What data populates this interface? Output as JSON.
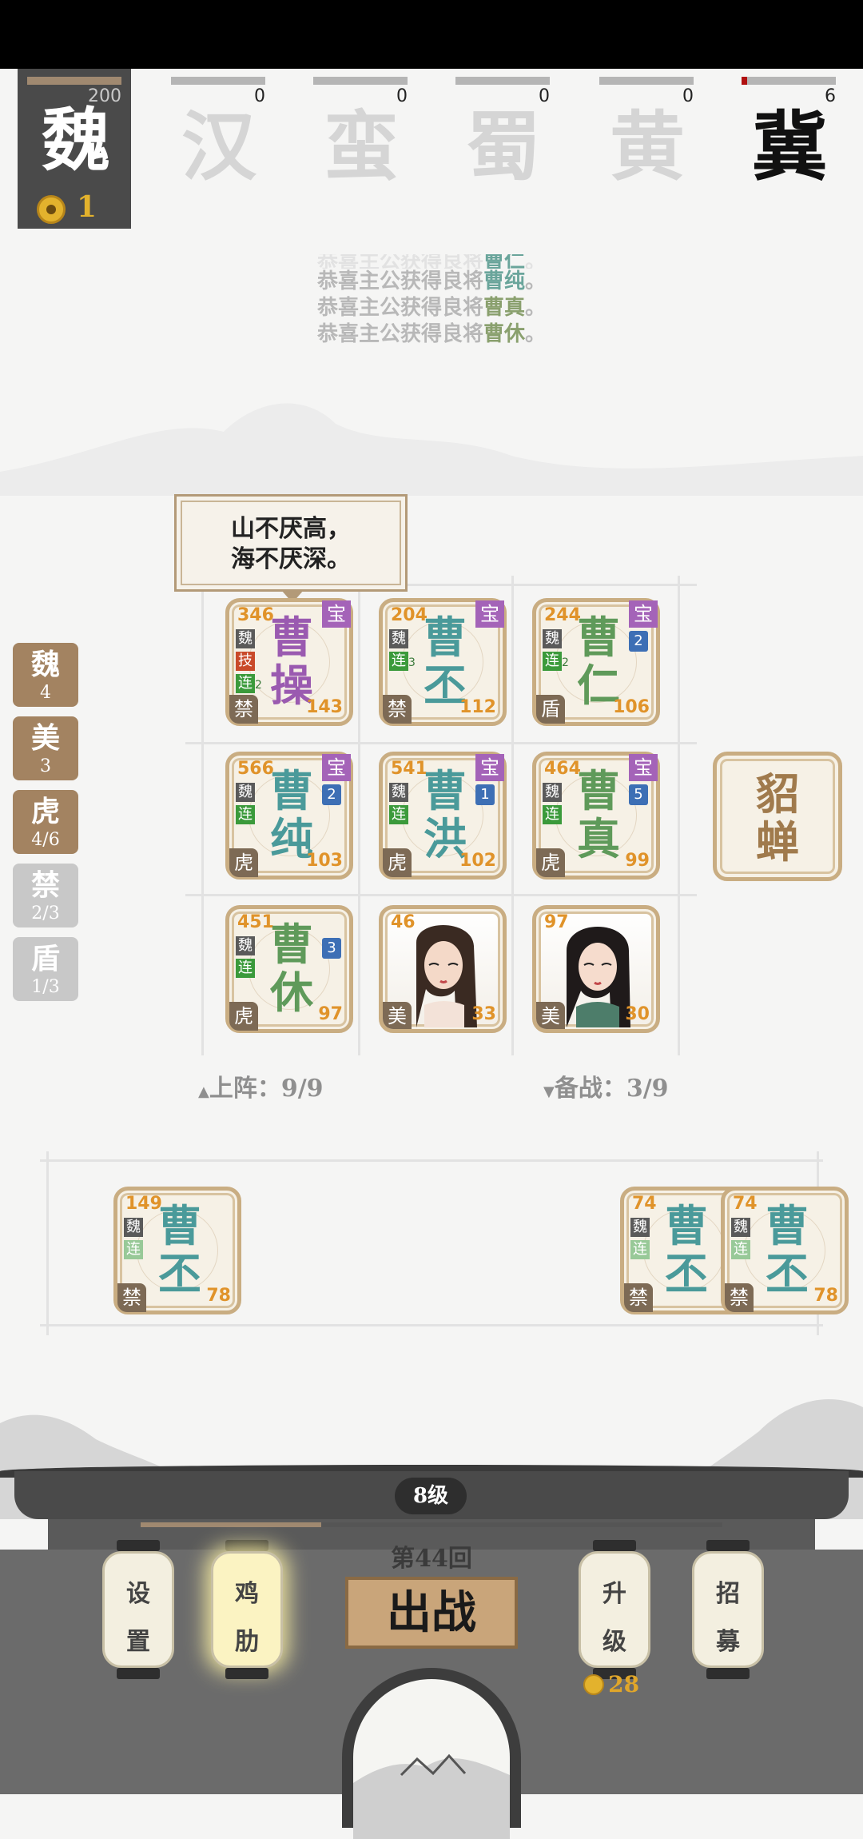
{
  "player": {
    "faction": "魏",
    "hp": "200",
    "coins": "1"
  },
  "enemies": [
    {
      "name": "汉",
      "value": "0",
      "bar_fill": 0
    },
    {
      "name": "蛮",
      "value": "0",
      "bar_fill": 0
    },
    {
      "name": "蜀",
      "value": "0",
      "bar_fill": 0
    },
    {
      "name": "黄",
      "value": "0",
      "bar_fill": 0
    },
    {
      "name": "冀",
      "value": "6",
      "bar_fill": 0.06
    }
  ],
  "messages": [
    {
      "prefix": "恭喜主公获得良将",
      "general": "曹仁",
      "suffix": "。"
    },
    {
      "prefix": "恭喜主公获得良将",
      "general": "曹纯",
      "suffix": "。"
    },
    {
      "prefix": "恭喜主公获得良将",
      "general": "曹真",
      "suffix": "。"
    },
    {
      "prefix": "恭喜主公获得良将",
      "general": "曹休",
      "suffix": "。"
    }
  ],
  "speech": {
    "line1": "山不厌高，",
    "line2": "海不厌深。"
  },
  "tabs": [
    {
      "label": "魏",
      "count": "4"
    },
    {
      "label": "美",
      "count": "3"
    },
    {
      "label": "虎",
      "count": "4/6"
    },
    {
      "label": "禁",
      "count": "2/3"
    },
    {
      "label": "盾",
      "count": "1/3"
    }
  ],
  "cards": [
    {
      "line1": "曹",
      "line2": "操",
      "attack": "346",
      "hp": "143",
      "type": "禁",
      "treasure": "宝",
      "star": "",
      "tags": [
        "魏",
        "技",
        "连"
      ],
      "lian_sub": "2"
    },
    {
      "line1": "曹",
      "line2": "丕",
      "attack": "204",
      "hp": "112",
      "type": "禁",
      "treasure": "宝",
      "star": "",
      "tags": [
        "魏",
        "连"
      ],
      "lian_sub": "3"
    },
    {
      "line1": "曹",
      "line2": "仁",
      "attack": "244",
      "hp": "106",
      "type": "盾",
      "treasure": "宝",
      "star": "2",
      "tags": [
        "魏",
        "连"
      ],
      "lian_sub": "2"
    },
    {
      "line1": "曹",
      "line2": "纯",
      "attack": "566",
      "hp": "103",
      "type": "虎",
      "treasure": "宝",
      "star": "2",
      "tags": [
        "魏",
        "连"
      ],
      "lian_sub": ""
    },
    {
      "line1": "曹",
      "line2": "洪",
      "attack": "541",
      "hp": "102",
      "type": "虎",
      "treasure": "宝",
      "star": "1",
      "tags": [
        "魏",
        "连"
      ],
      "lian_sub": ""
    },
    {
      "line1": "曹",
      "line2": "真",
      "attack": "464",
      "hp": "99",
      "type": "虎",
      "treasure": "宝",
      "star": "5",
      "tags": [
        "魏",
        "连"
      ],
      "lian_sub": ""
    },
    {
      "line1": "曹",
      "line2": "休",
      "attack": "451",
      "hp": "97",
      "type": "虎",
      "treasure": "",
      "star": "3",
      "tags": [
        "魏",
        "连"
      ],
      "lian_sub": ""
    },
    {
      "portrait": true,
      "attack": "46",
      "hp": "33",
      "type": "美"
    },
    {
      "portrait": true,
      "attack": "97",
      "hp": "30",
      "type": "美"
    }
  ],
  "diaochan": {
    "name": "貂蝉"
  },
  "deployed_counter": "上阵：9/9",
  "bench_counter": "备战：3/9",
  "bench_cards": [
    {
      "line1": "曹",
      "line2": "丕",
      "attack": "149",
      "hp": "78",
      "type": "禁"
    },
    {
      "line1": "曹",
      "line2": "丕",
      "attack": "74",
      "hp": "7",
      "type": "禁"
    },
    {
      "line1": "曹",
      "line2": "丕",
      "attack": "74",
      "hp": "78",
      "type": "禁"
    }
  ],
  "bottom": {
    "level": "8级",
    "round": "第44回",
    "level_progress": 0.31,
    "settings": "设置",
    "chicken": "鸡肋",
    "battle": "出战",
    "upgrade": "升级",
    "upgrade_cost": "28",
    "recruit": "招募"
  },
  "colors": {
    "accent": "#c9ad82",
    "purple": "#9a5ab0",
    "teal": "#4a9a9a",
    "green": "#5f9a5a",
    "gold": "#e3b22d"
  }
}
